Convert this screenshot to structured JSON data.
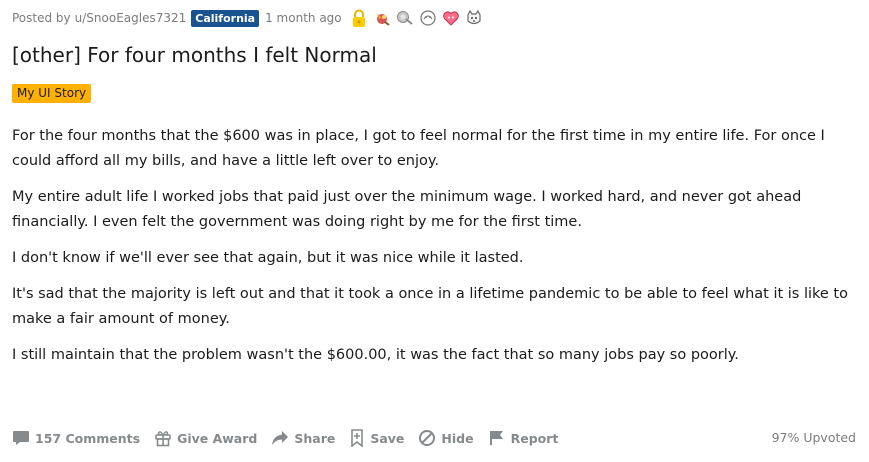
{
  "post": {
    "meta": {
      "posted_by_prefix": "Posted by",
      "author": "u/SnooEagles7321",
      "user_flair": "California",
      "time": "1 month ago",
      "awards": [
        "lock-award-icon",
        "rocket-award-icon",
        "silver-award-icon",
        "helpful-award-icon",
        "wholesome-award-icon",
        "doge-award-icon"
      ]
    },
    "title": "[other] For four months I felt Normal",
    "link_flair": "My UI Story",
    "paragraphs": [
      "For the four months that the $600 was in place, I got to feel normal for the first time in my entire life. For once I could afford all my bills, and have a little left over to enjoy.",
      "My entire adult life I worked jobs that paid just over the minimum wage. I worked hard, and never got ahead financially. I even felt the government was doing right by me for the first time.",
      "I don't know if we'll ever see that again, but it was nice while it lasted.",
      "It's sad that the majority is left out and that it took a once in a lifetime pandemic to be able to feel what it is like to make a fair amount of money.",
      "I still maintain that the problem wasn't the $600.00, it was the fact that so many jobs pay so poorly."
    ],
    "actions": {
      "comments": "157 Comments",
      "give_award": "Give Award",
      "share": "Share",
      "save": "Save",
      "hide": "Hide",
      "report": "Report"
    },
    "upvoted": "97% Upvoted"
  },
  "colors": {
    "user_flair_bg": "#1a5490",
    "link_flair_bg": "#ffb000",
    "muted_text": "#878a8c"
  }
}
